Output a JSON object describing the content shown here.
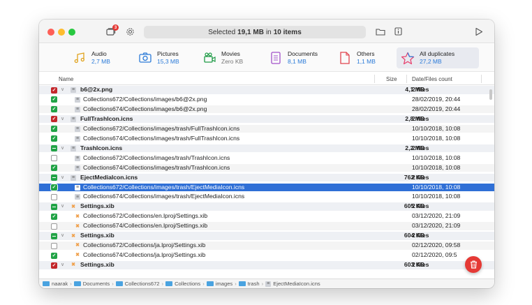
{
  "titlebar": {
    "status_prefix": "Selected",
    "status_size": "19,1 MB",
    "status_mid": "in",
    "status_count": "10 items",
    "badge_count": "3"
  },
  "categories": [
    {
      "name": "Audio",
      "size": "2,7 MB",
      "icon": "music-note-icon"
    },
    {
      "name": "Pictures",
      "size": "15,3 MB",
      "icon": "camera-icon"
    },
    {
      "name": "Movies",
      "size": "Zero KB",
      "icon": "film-icon"
    },
    {
      "name": "Documents",
      "size": "8,1 MB",
      "icon": "document-icon"
    },
    {
      "name": "Others",
      "size": "1,1 MB",
      "icon": "file-icon"
    },
    {
      "name": "All duplicates",
      "size": "27,2 MB",
      "icon": "star-icon"
    }
  ],
  "columns": {
    "name": "Name",
    "size": "Size",
    "date": "Date/Files count"
  },
  "rows": [
    {
      "type": "group",
      "check": "red",
      "icon": "gray",
      "name": "b6@2x.png",
      "size": "4,1 MB",
      "date": "2 files"
    },
    {
      "type": "item",
      "check": "checked",
      "icon": "gray",
      "name": "Collections672/Collections/images/b6@2x.png",
      "date": "28/02/2019, 20:44"
    },
    {
      "type": "item",
      "check": "checked",
      "icon": "gray",
      "name": "Collections674/Collections/images/b6@2x.png",
      "date": "28/02/2019, 20:44"
    },
    {
      "type": "group",
      "check": "red",
      "icon": "gray",
      "name": "FullTrashIcon.icns",
      "size": "2,8 MB",
      "date": "2 files"
    },
    {
      "type": "item",
      "check": "checked",
      "icon": "gray",
      "name": "Collections672/Collections/images/trash/FullTrashIcon.icns",
      "date": "10/10/2018, 10:08"
    },
    {
      "type": "item",
      "check": "checked",
      "icon": "gray",
      "name": "Collections674/Collections/images/trash/FullTrashIcon.icns",
      "date": "10/10/2018, 10:08"
    },
    {
      "type": "group",
      "check": "mixed",
      "icon": "gray",
      "name": "TrashIcon.icns",
      "size": "2,2 MB",
      "date": "2 files"
    },
    {
      "type": "item",
      "check": "empty",
      "icon": "gray",
      "name": "Collections672/Collections/images/trash/TrashIcon.icns",
      "date": "10/10/2018, 10:08"
    },
    {
      "type": "item",
      "check": "checked",
      "icon": "gray",
      "name": "Collections674/Collections/images/trash/TrashIcon.icns",
      "date": "10/10/2018, 10:08"
    },
    {
      "type": "group",
      "check": "mixed",
      "icon": "gray",
      "name": "EjectMediaIcon.icns",
      "size": "762 KB",
      "date": "2 files"
    },
    {
      "type": "item",
      "check": "checked",
      "icon": "gray",
      "name": "Collections672/Collections/images/trash/EjectMediaIcon.icns",
      "date": "10/10/2018, 10:08",
      "selected": true
    },
    {
      "type": "item",
      "check": "empty",
      "icon": "gray",
      "name": "Collections674/Collections/images/trash/EjectMediaIcon.icns",
      "date": "10/10/2018, 10:08"
    },
    {
      "type": "group",
      "check": "mixed",
      "icon": "xib",
      "name": "Settings.xib",
      "size": "605 KB",
      "date": "2 files"
    },
    {
      "type": "item",
      "check": "checked",
      "icon": "xib",
      "name": "Collections672/Collections/en.lproj/Settings.xib",
      "date": "03/12/2020, 21:09"
    },
    {
      "type": "item",
      "check": "empty",
      "icon": "xib",
      "name": "Collections674/Collections/en.lproj/Settings.xib",
      "date": "03/12/2020, 21:09"
    },
    {
      "type": "group",
      "check": "mixed",
      "icon": "xib",
      "name": "Settings.xib",
      "size": "604 KB",
      "date": "2 files"
    },
    {
      "type": "item",
      "check": "empty",
      "icon": "xib",
      "name": "Collections672/Collections/ja.lproj/Settings.xib",
      "date": "02/12/2020, 09:58"
    },
    {
      "type": "item",
      "check": "checked",
      "icon": "xib",
      "name": "Collections674/Collections/ja.lproj/Settings.xib",
      "date": "02/12/2020, 09:5"
    },
    {
      "type": "group",
      "check": "red",
      "icon": "xib",
      "name": "Settings.xib",
      "size": "603 KB",
      "date": "2 files"
    }
  ],
  "path": [
    "naarak",
    "Documents",
    "Collections672",
    "Collections",
    "images",
    "trash",
    "EjectMediaIcon.icns"
  ],
  "colors": {
    "accent": "#2f6fd6",
    "check_green": "#21a346",
    "check_red": "#c3272b",
    "delete_red": "#e53935"
  }
}
